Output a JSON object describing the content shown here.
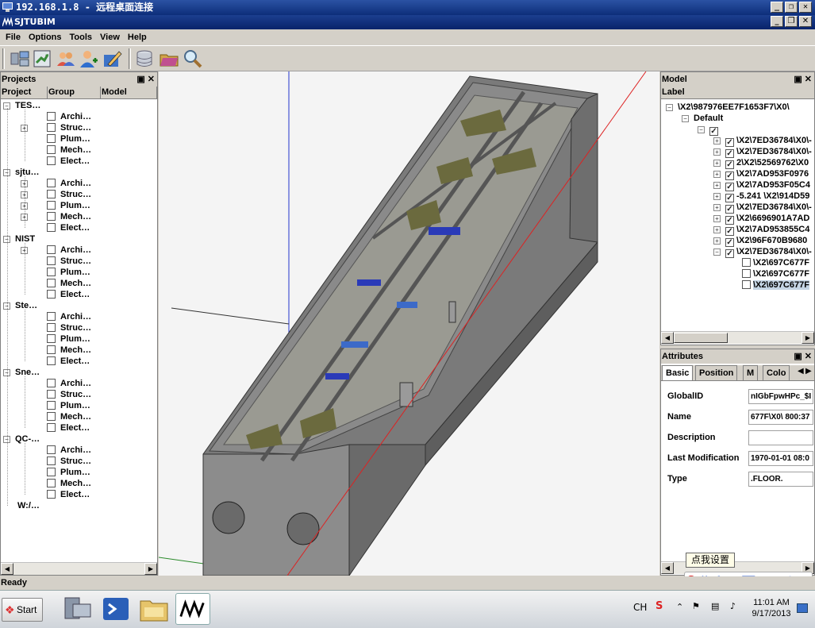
{
  "rdp_window": {
    "title": "192.168.1.8 - 远程桌面连接"
  },
  "app": {
    "title": "SJTUBIM"
  },
  "window_controls": {
    "minimize": "_",
    "restore": "❐",
    "close": "✕"
  },
  "menu": [
    "File",
    "Options",
    "Tools",
    "View",
    "Help"
  ],
  "toolbar_icons": [
    "server-connect-icon",
    "import-icon",
    "users-icon",
    "add-user-icon",
    "edit-icon",
    "database-icon",
    "open-folder-icon",
    "search-icon"
  ],
  "projects_panel": {
    "title": "Projects",
    "columns": [
      "Project",
      "Group",
      "Model"
    ],
    "projects": [
      {
        "name": "TES…",
        "groups": [
          "Archi…",
          "Struc…",
          "Plum…",
          "Mech…",
          "Elect…"
        ]
      },
      {
        "name": "sjtu…",
        "groups": [
          "Archi…",
          "Struc…",
          "Plum…",
          "Mech…",
          "Elect…"
        ]
      },
      {
        "name": "NIST",
        "groups": [
          "Archi…",
          "Struc…",
          "Plum…",
          "Mech…",
          "Elect…"
        ]
      },
      {
        "name": "Ste…",
        "groups": [
          "Archi…",
          "Struc…",
          "Plum…",
          "Mech…",
          "Elect…"
        ]
      },
      {
        "name": "Sne…",
        "groups": [
          "Archi…",
          "Struc…",
          "Plum…",
          "Mech…",
          "Elect…"
        ]
      },
      {
        "name": "QC-…",
        "groups": [
          "Archi…",
          "Struc…",
          "Plum…",
          "Mech…",
          "Elect…"
        ]
      }
    ],
    "last_item": "W:/…"
  },
  "model_panel": {
    "title": "Model",
    "column": "Label",
    "root": "\\X2\\987976EE7F1653F7\\X0\\",
    "default_node": "Default",
    "items": [
      "\\X2\\7ED36784\\X0\\-",
      "\\X2\\7ED36784\\X0\\-",
      "2\\X2\\52569762\\X0",
      "\\X2\\7AD953F0976",
      "\\X2\\7AD953F05C4",
      "-5.241 \\X2\\914D59",
      "\\X2\\7ED36784\\X0\\-",
      "\\X2\\6696901A7AD",
      "\\X2\\7AD953855C4",
      "\\X2\\96F670B9680",
      "\\X2\\7ED36784\\X0\\-"
    ],
    "subitems": [
      "\\X2\\697C677F",
      "\\X2\\697C677F",
      "\\X2\\697C677F"
    ]
  },
  "attributes_panel": {
    "title": "Attributes",
    "tabs": [
      "Basic",
      "Position",
      "M",
      "Colo"
    ],
    "fields": [
      {
        "label": "GlobalID",
        "value": "nIGbFpwHPc_$I"
      },
      {
        "label": "Name",
        "value": "677F\\X0\\ 800:37"
      },
      {
        "label": "Description",
        "value": ""
      },
      {
        "label": "Last Modification",
        "value": "1970-01-01 08:0"
      },
      {
        "label": "Type",
        "value": ".FLOOR."
      }
    ]
  },
  "status": {
    "text": "Ready"
  },
  "taskbar": {
    "start_label": "Start",
    "lang": "CH",
    "time": "11:01 AM",
    "date": "9/17/2013"
  },
  "ime": {
    "tooltip": "点我设置",
    "mode": "英"
  }
}
